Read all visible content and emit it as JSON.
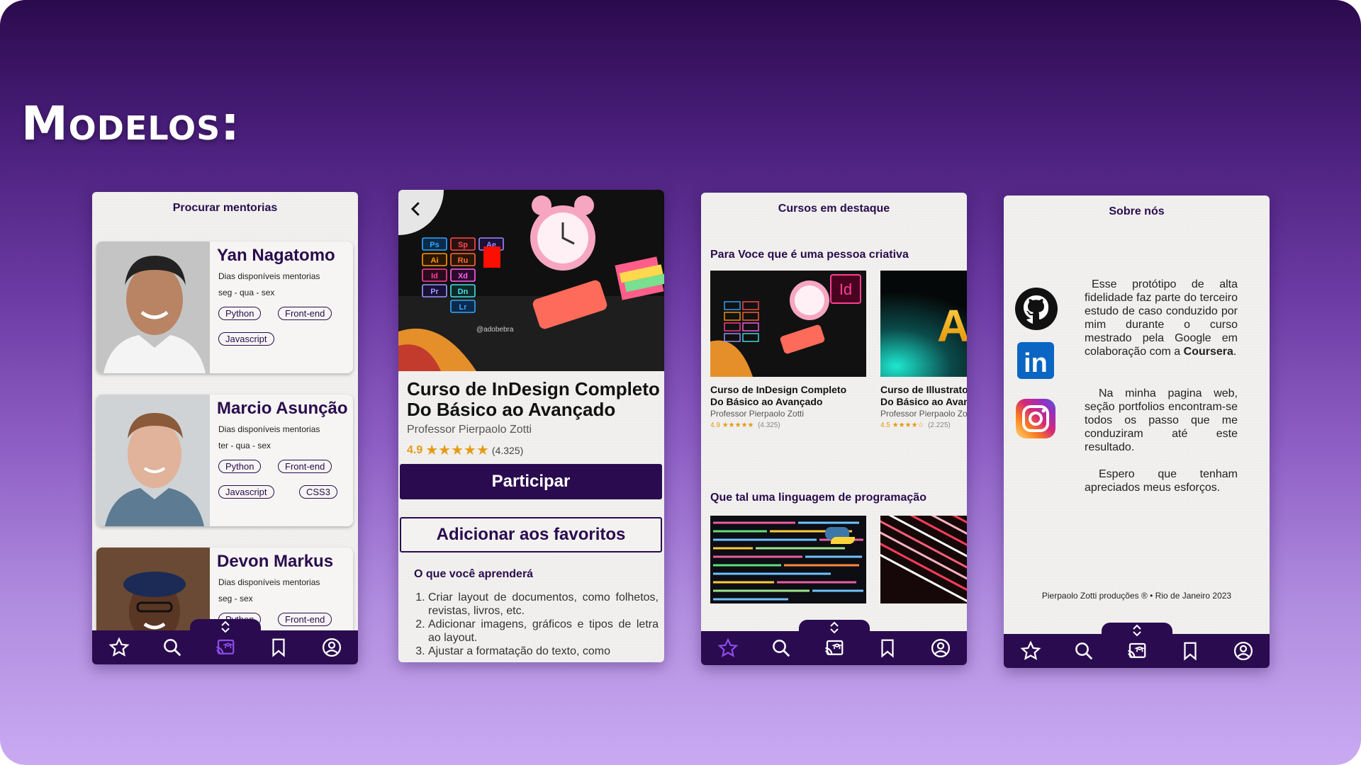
{
  "page_title": "Modelos:",
  "colors": {
    "brand": "#2a0b4f",
    "rating": "#e59a17",
    "active_nav": "#8a4ce8"
  },
  "nav_icons": [
    "star-icon",
    "search-icon",
    "cast-icon",
    "bookmark-icon",
    "user-icon"
  ],
  "screen1": {
    "header": "Procurar mentorias",
    "mentors": [
      {
        "name": "Yan Nagatomo",
        "sub": "Dias disponíveis mentorias",
        "days": "seg - qua - sex",
        "tags": [
          "Python",
          "Front-end",
          "Javascript"
        ]
      },
      {
        "name": "Marcio Asunção",
        "sub": "Dias disponíveis mentorias",
        "days": "ter - qua - sex",
        "tags": [
          "Python",
          "Front-end",
          "Javascript",
          "CSS3"
        ]
      },
      {
        "name": "Devon Markus",
        "sub": "Dias disponíveis mentorias",
        "days": "seg - sex",
        "tags": [
          "Python",
          "Front-end"
        ]
      }
    ],
    "active_nav": "cast"
  },
  "screen2": {
    "course_title": "Curso de InDesign Completo Do Básico ao Avançado",
    "professor": "Professor Pierpaolo Zotti",
    "rating": "4.9",
    "stars": "★★★★★",
    "reviews": "(4.325)",
    "participate_label": "Participar",
    "favorite_label": "Adicionar aos favoritos",
    "learn_heading": "O que você aprenderá",
    "learn_items": [
      "Criar layout de documentos, como folhetos, revistas, livros, etc.",
      "Adicionar imagens, gráficos e tipos de letra ao layout.",
      "Ajustar a formatação do texto, como"
    ],
    "photo_text": {
      "apps": [
        "Ps",
        "Sp",
        "Ae",
        "Ai",
        "Ru",
        "Id",
        "Xd",
        "Pr",
        "Dn",
        "Lr"
      ],
      "tag": "@adobebra"
    }
  },
  "screen3": {
    "header": "Cursos em destaque",
    "section1": "Para Voce que é uma pessoa criativa",
    "section2": "Que tal  uma linguagem de programação",
    "courses": [
      {
        "title1": "Curso de InDesign Completo",
        "title2": "Do Básico ao Avançado",
        "prof": "Professor Pierpaolo Zotti",
        "rating": "4.9",
        "stars": "★★★★★",
        "reviews": "(4.325)"
      },
      {
        "title1": "Curso de Illustrator",
        "title2": "Do Básico ao Avançado",
        "prof": "Professor Pierpaolo Zotti",
        "rating": "4.5",
        "stars": "★★★★☆",
        "reviews": "(2.225)"
      }
    ],
    "thumb_badges": {
      "indesign": "Id",
      "illustrator": "Ai"
    },
    "active_nav": "star"
  },
  "screen4": {
    "header": "Sobre nós",
    "paragraph1_pre": "Esse protótipo de alta fidelidade faz parte do terceiro estudo de caso conduzido por mim durante o curso mestrado pela Google em colaboração com a ",
    "paragraph1_bold": "Coursera",
    "paragraph1_post": ".",
    "paragraph2": "Na minha pagina web, seção portfolios encontram-se todos os passo que me conduziram até este resultado.",
    "paragraph3": "Espero que tenham apreciados meus esforços.",
    "linkedin_label": "in",
    "footer": "Pierpaolo Zotti produções ®  •  Rio de Janeiro 2023"
  }
}
